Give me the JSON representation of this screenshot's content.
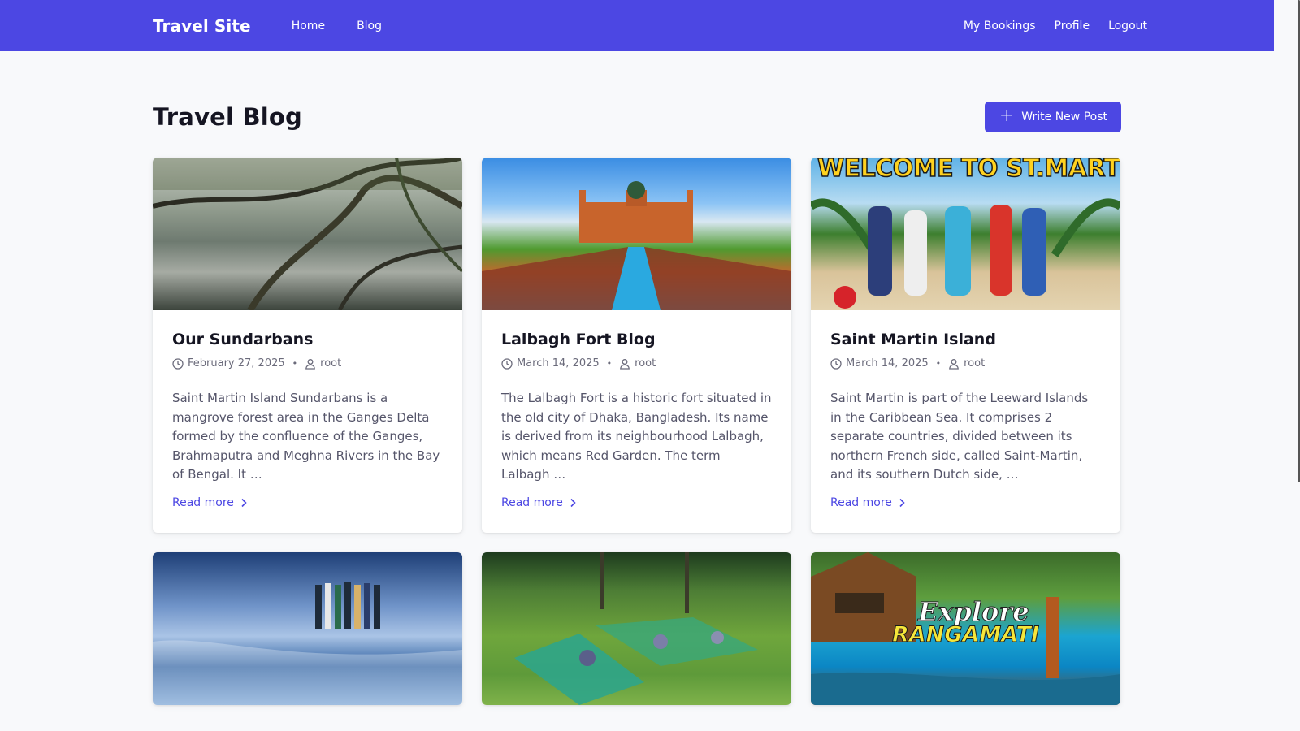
{
  "navbar": {
    "brand": "Travel Site",
    "left_links": [
      "Home",
      "Blog"
    ],
    "right_links": [
      "My Bookings",
      "Profile",
      "Logout"
    ]
  },
  "page": {
    "title": "Travel Blog",
    "new_post_label": "Write New Post"
  },
  "colors": {
    "primary": "#4c47e3"
  },
  "posts": [
    {
      "title": "Our Sundarbans",
      "date": "February 27, 2025",
      "author": "root",
      "excerpt": "Saint Martin Island Sundarbans is a mangrove forest area in the Ganges Delta formed by the confluence of the Ganges, Brahmaputra and Meghna Rivers in the Bay of Bengal. It …",
      "read_more": "Read more"
    },
    {
      "title": "Lalbagh Fort Blog",
      "date": "March 14, 2025",
      "author": "root",
      "excerpt": "The Lalbagh Fort is a historic fort situated in the old city of Dhaka, Bangladesh. Its name is derived from its neighbourhood Lalbagh, which means Red Garden. The term Lalbagh …",
      "read_more": "Read more"
    },
    {
      "title": "Saint Martin Island",
      "date": "March 14, 2025",
      "author": "root",
      "excerpt": "Saint Martin is part of the Leeward Islands in the Caribbean Sea. It comprises 2 separate countries, divided between its northern French side, called Saint-Martin, and its southern Dutch side, …",
      "read_more": "Read more",
      "image_text": "WELCOME TO ST.MARTIN"
    }
  ],
  "second_row_images": {
    "rangamati_line1": "Explore",
    "rangamati_line2": "RANGAMATI"
  }
}
